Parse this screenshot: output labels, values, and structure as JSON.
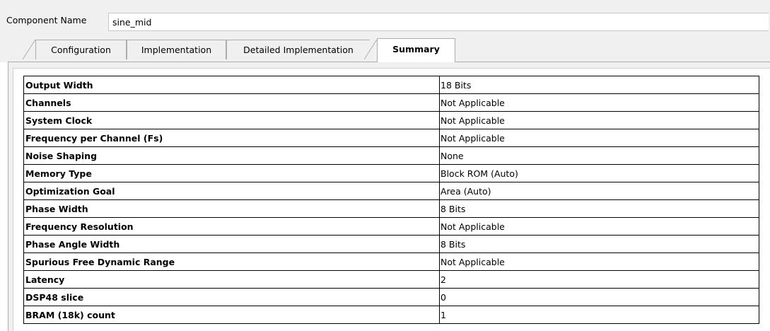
{
  "component": {
    "name_label": "Component Name",
    "name_value": "sine_mid"
  },
  "tabs": [
    {
      "label": "Configuration",
      "active": false
    },
    {
      "label": "Implementation",
      "active": false
    },
    {
      "label": "Detailed Implementation",
      "active": false
    },
    {
      "label": "Summary",
      "active": true
    }
  ],
  "summary": {
    "rows": [
      {
        "key": "Output Width",
        "value": "18 Bits"
      },
      {
        "key": "Channels",
        "value": "Not Applicable"
      },
      {
        "key": "System Clock",
        "value": "Not Applicable"
      },
      {
        "key": "Frequency per Channel (Fs)",
        "value": "Not Applicable"
      },
      {
        "key": "Noise Shaping",
        "value": "None"
      },
      {
        "key": "Memory Type",
        "value": "Block ROM (Auto)"
      },
      {
        "key": "Optimization Goal",
        "value": "Area (Auto)"
      },
      {
        "key": "Phase Width",
        "value": "8 Bits"
      },
      {
        "key": "Frequency Resolution",
        "value": "Not Applicable"
      },
      {
        "key": "Phase Angle Width",
        "value": "8 Bits"
      },
      {
        "key": "Spurious Free Dynamic Range",
        "value": "Not Applicable"
      },
      {
        "key": "Latency",
        "value": "2"
      },
      {
        "key": "DSP48 slice",
        "value": "0"
      },
      {
        "key": "BRAM (18k) count",
        "value": "1"
      }
    ]
  }
}
